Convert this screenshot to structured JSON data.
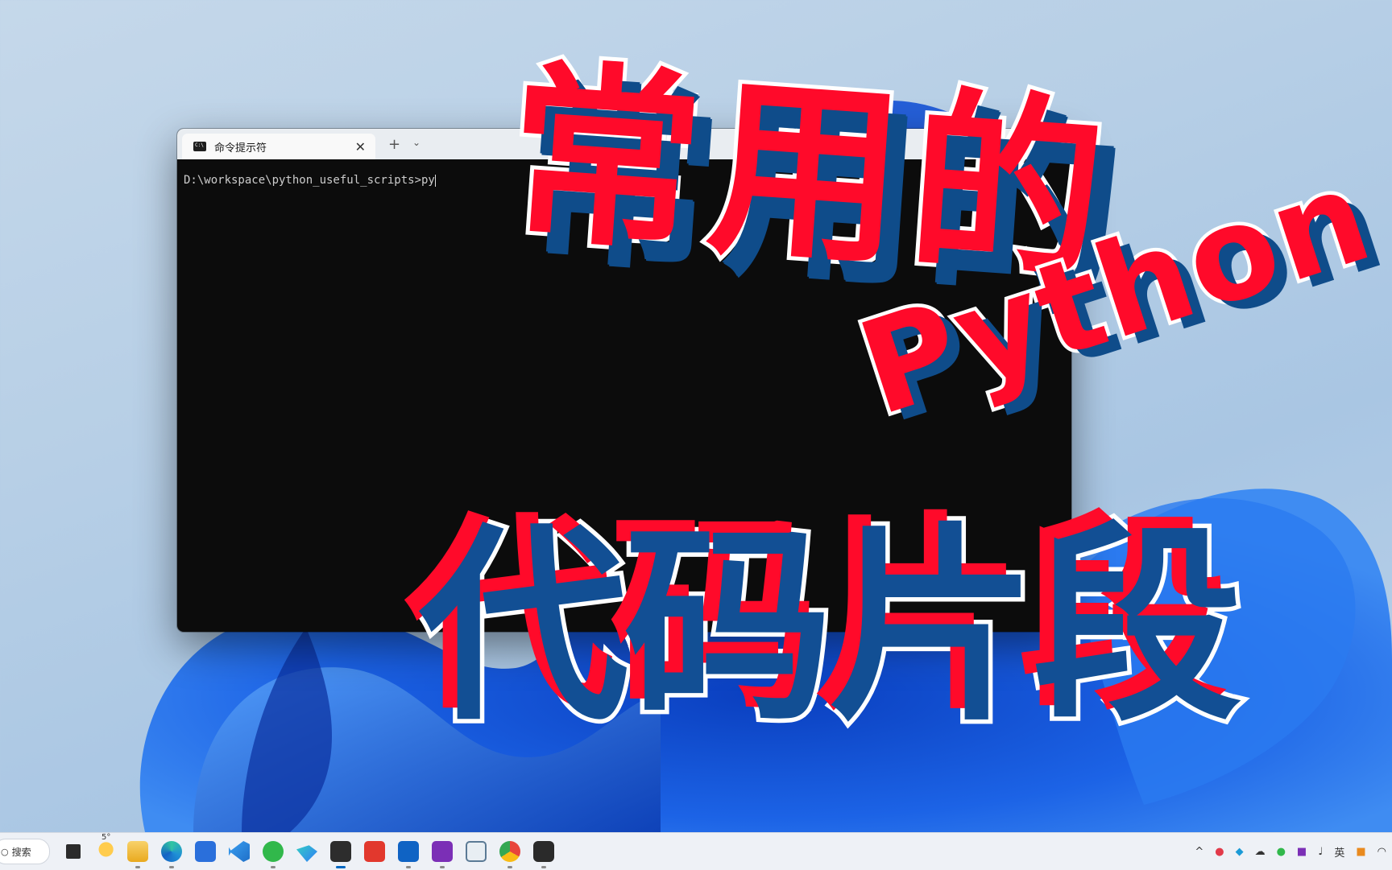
{
  "terminal": {
    "tab_title": "命令提示符",
    "close_glyph": "✕",
    "add_glyph": "+",
    "dropdown_glyph": "⌄",
    "prompt_line": "D:\\workspace\\python_useful_scripts>py"
  },
  "overlay": {
    "line1": "常用的",
    "line2": "Python",
    "line3": "代码片段"
  },
  "taskbar": {
    "search_label": "搜索",
    "weather_temp": "5°",
    "apps": [
      {
        "name": "task-view-icon",
        "color": "#2b2b2b"
      },
      {
        "name": "weather-icon",
        "color": "#f5a623"
      },
      {
        "name": "file-explorer-icon",
        "color": "#f2b632"
      },
      {
        "name": "edge-icon",
        "color": "#1f8fd6"
      },
      {
        "name": "store-icon",
        "color": "#2a6fdb"
      },
      {
        "name": "vscode-icon",
        "color": "#1f7ad6"
      },
      {
        "name": "wechat-icon",
        "color": "#31b84b"
      },
      {
        "name": "feishu-icon",
        "color": "#2f7cf6"
      },
      {
        "name": "terminal-icon",
        "color": "#2d2d2d"
      },
      {
        "name": "wps-icon",
        "color": "#e2382d"
      },
      {
        "name": "outlook-icon",
        "color": "#0f63c4"
      },
      {
        "name": "onenote-icon",
        "color": "#7b2fb6"
      },
      {
        "name": "whiteboard-icon",
        "color": "#5b7a95"
      },
      {
        "name": "chrome-icon",
        "color": "#e8453c"
      },
      {
        "name": "bilibili-icon",
        "color": "#2a2a2a"
      }
    ],
    "tray": {
      "chevron": "^",
      "ime": "英"
    }
  }
}
